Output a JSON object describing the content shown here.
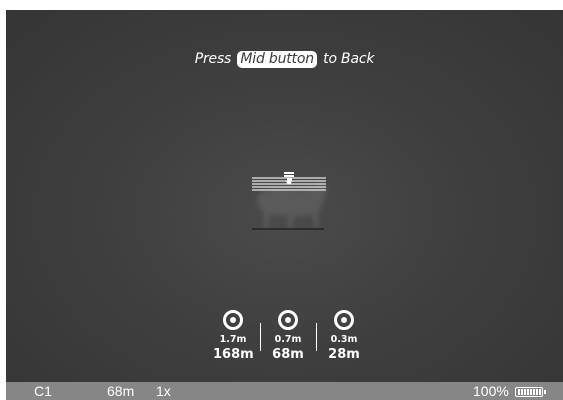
{
  "hint": {
    "prefix": "Press",
    "highlight": "Mid button",
    "suffix": "to Back"
  },
  "markers": [
    {
      "size": "1.7m",
      "distance": "168m"
    },
    {
      "size": "0.7m",
      "distance": "68m"
    },
    {
      "size": "0.3m",
      "distance": "28m"
    }
  ],
  "status": {
    "profile": "C1",
    "distance": "68m",
    "zoom": "1x",
    "battery": "100%",
    "battery_level": 1.0
  },
  "colors": {
    "viewport": "#3f3f3f",
    "statusbar": "#868686",
    "text": "#ffffff"
  },
  "icons": {
    "marker": "stadiametric-target-icon",
    "battery": "battery-icon",
    "target": "animal-silhouette"
  }
}
